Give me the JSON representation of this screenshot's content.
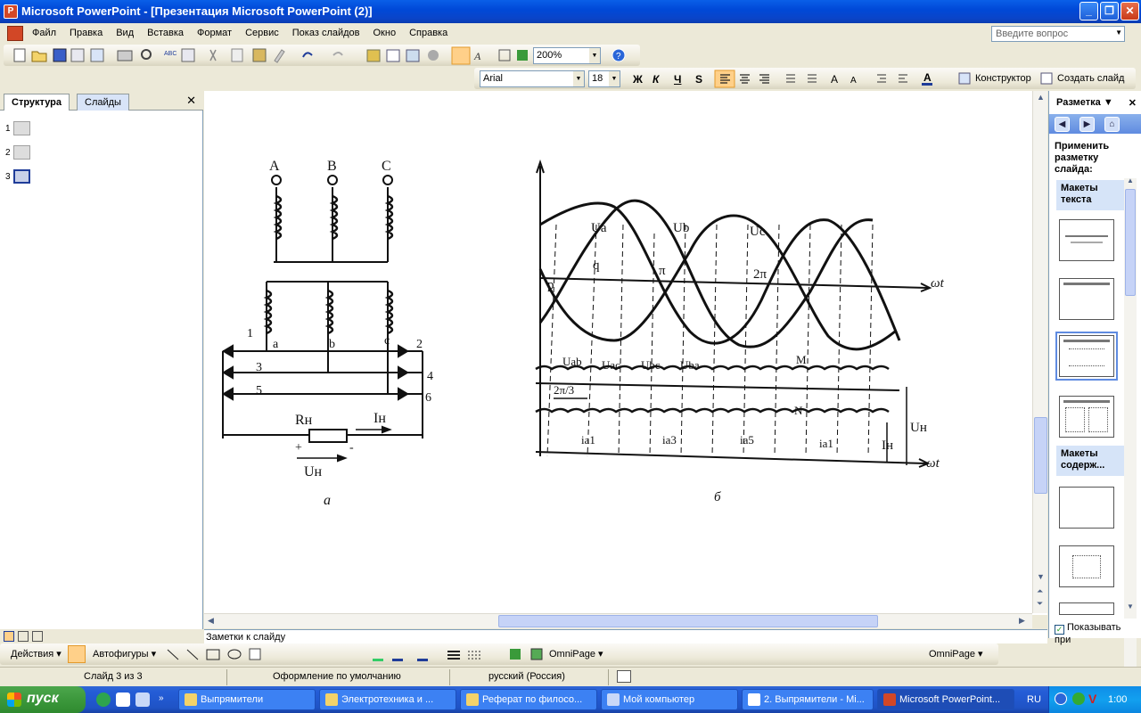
{
  "window": {
    "title": "Microsoft PowerPoint - [Презентация Microsoft PowerPoint (2)]",
    "min": "_",
    "max": "❐",
    "close": "✕"
  },
  "menu": {
    "items": [
      "Файл",
      "Правка",
      "Вид",
      "Вставка",
      "Формат",
      "Сервис",
      "Показ слайдов",
      "Окно",
      "Справка"
    ],
    "help_placeholder": "Введите вопрос"
  },
  "standard_toolbar": {
    "zoom": "200%"
  },
  "format_toolbar": {
    "font": "Arial",
    "size": "18",
    "bold": "Ж",
    "italic": "К",
    "underline": "Ч",
    "shadow": "S",
    "designer": "Конструктор",
    "new_slide": "Создать слайд"
  },
  "left_pane": {
    "tab_outline": "Структура",
    "tab_slides": "Слайды",
    "close": "✕",
    "slides": [
      "1",
      "2",
      "3"
    ]
  },
  "slide": {
    "circuit": {
      "phases": [
        "A",
        "B",
        "C"
      ],
      "taps": [
        "a",
        "b",
        "c"
      ],
      "diodes": [
        "1",
        "2",
        "3",
        "4",
        "5",
        "6"
      ],
      "resistor": "Rн",
      "current": "Iн",
      "voltage": "Uн",
      "plus": "+",
      "minus": "-",
      "caption": "а"
    },
    "waveform": {
      "phase_labels": [
        "Ua",
        "Ub",
        "Uc"
      ],
      "axis_label": "ωt",
      "axis_label2": "ωt",
      "point_p": "p",
      "point_q": "q",
      "pi": "π",
      "two_pi": "2π",
      "line_labels": [
        "Uab",
        "Uac",
        "Ubc",
        "Uba"
      ],
      "period": "2π/3",
      "point_m": "M",
      "point_n": "N",
      "currents": [
        "ia1",
        "ia3",
        "ia5",
        "ia1"
      ],
      "ud": "Uн",
      "id": "Iн",
      "caption": "б"
    }
  },
  "notes": {
    "placeholder": "Заметки к слайду"
  },
  "task_pane": {
    "title": "Разметка",
    "apply_label": "Применить разметку слайда:",
    "group_text": "Макеты текста",
    "group_content": "Макеты содерж...",
    "show_on_insert": "Показывать при"
  },
  "drawing_toolbar": {
    "actions": "Действия",
    "autoshapes": "Автофигуры",
    "omnipage1": "OmniPage",
    "omnipage2": "OmniPage"
  },
  "status_bar": {
    "slide": "Слайд 3 из 3",
    "design": "Оформление по умолчанию",
    "lang": "русский (Россия)"
  },
  "taskbar": {
    "start": "пуск",
    "tasks": [
      "Выпрямители",
      "Электротехника и ...",
      "Реферат по филосо...",
      "Мой компьютер",
      "2. Выпрямители - Mi...",
      "Microsoft PowerPoint..."
    ],
    "lang": "RU",
    "clock": "1:00"
  }
}
